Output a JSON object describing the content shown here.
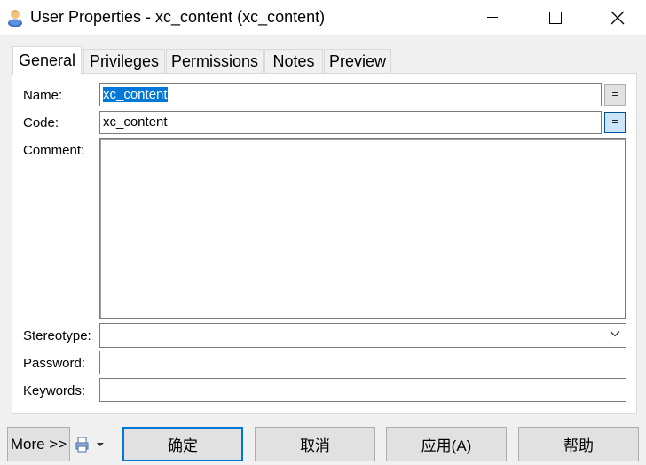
{
  "window": {
    "title": "User Properties - xc_content (xc_content)",
    "minimize_icon": "minimize-icon",
    "maximize_icon": "maximize-icon",
    "close_icon": "close-icon"
  },
  "tabs": [
    {
      "label": "General",
      "active": true
    },
    {
      "label": "Privileges",
      "active": false
    },
    {
      "label": "Permissions",
      "active": false
    },
    {
      "label": "Notes",
      "active": false
    },
    {
      "label": "Preview",
      "active": false
    }
  ],
  "form": {
    "name_label": "Name:",
    "name_value": "xc_content",
    "code_label": "Code:",
    "code_value": "xc_content",
    "sync_button_label": "=",
    "comment_label": "Comment:",
    "comment_value": "",
    "stereotype_label": "Stereotype:",
    "stereotype_value": "",
    "password_label": "Password:",
    "password_value": "",
    "keywords_label": "Keywords:",
    "keywords_value": ""
  },
  "footer": {
    "more_label": "More >>",
    "print_icon": "print-icon",
    "ok_label": "确定",
    "cancel_label": "取消",
    "apply_label": "应用(A)",
    "help_label": "帮助"
  },
  "colors": {
    "selection": "#0078d7",
    "default_button_border": "#0078d7",
    "pressed_button": "#cce4f7"
  }
}
